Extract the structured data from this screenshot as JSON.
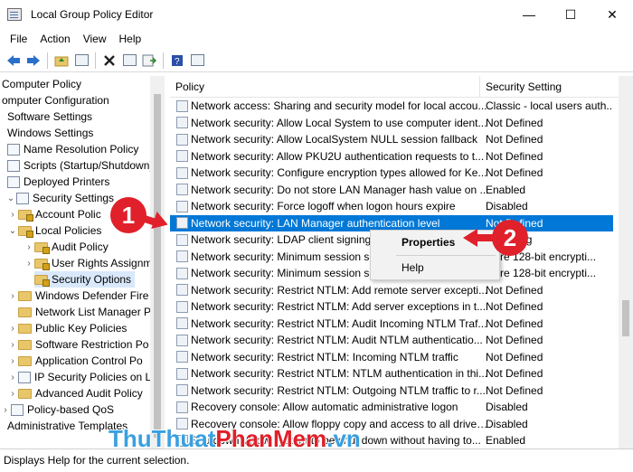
{
  "window": {
    "title": "Local Group Policy Editor",
    "minimize": "—",
    "maximize": "☐",
    "close": "✕"
  },
  "menu": [
    "File",
    "Action",
    "View",
    "Help"
  ],
  "tree": [
    {
      "label": "Computer Policy",
      "chev": ""
    },
    {
      "label": "omputer Configuration",
      "chev": ""
    },
    {
      "label": "Software Settings",
      "chev": ""
    },
    {
      "label": "Windows Settings",
      "chev": ""
    },
    {
      "label": "Name Resolution Policy",
      "chev": ""
    },
    {
      "label": "Scripts (Startup/Shutdown)",
      "chev": ""
    },
    {
      "label": "Deployed Printers",
      "chev": ""
    },
    {
      "label": "Security Settings",
      "chev": "⌄"
    },
    {
      "label": "Account Polic",
      "chev": "›"
    },
    {
      "label": "Local Policies",
      "chev": "⌄"
    },
    {
      "label": "Audit Policy",
      "chev": "›"
    },
    {
      "label": "User Rights Assignm",
      "chev": "›"
    },
    {
      "label": "Security Options",
      "chev": ""
    },
    {
      "label": "Windows Defender Fire",
      "chev": "›"
    },
    {
      "label": "Network List Manager P",
      "chev": ""
    },
    {
      "label": "Public Key Policies",
      "chev": "›"
    },
    {
      "label": "Software Restriction Po",
      "chev": "›"
    },
    {
      "label": "Application Control Po",
      "chev": "›"
    },
    {
      "label": "IP Security Policies on L",
      "chev": "›"
    },
    {
      "label": "Advanced Audit Policy",
      "chev": "›"
    },
    {
      "label": "Policy-based QoS",
      "chev": "›"
    },
    {
      "label": "Administrative Templates",
      "chev": ""
    }
  ],
  "columns": {
    "policy": "Policy",
    "setting": "Security Setting"
  },
  "rows": [
    {
      "policy": "Network access: Sharing and security model for local accou...",
      "setting": "Classic - local users auth..."
    },
    {
      "policy": "Network security: Allow Local System to use computer ident...",
      "setting": "Not Defined"
    },
    {
      "policy": "Network security: Allow LocalSystem NULL session fallback",
      "setting": "Not Defined"
    },
    {
      "policy": "Network security: Allow PKU2U authentication requests to t...",
      "setting": "Not Defined"
    },
    {
      "policy": "Network security: Configure encryption types allowed for Ke...",
      "setting": "Not Defined"
    },
    {
      "policy": "Network security: Do not store LAN Manager hash value on ...",
      "setting": "Enabled"
    },
    {
      "policy": "Network security: Force logoff when logon hours expire",
      "setting": "Disabled"
    },
    {
      "policy": "Network security: LAN Manager authentication level",
      "setting": "Not Defined"
    },
    {
      "policy": "Network security: LDAP client signing r",
      "setting": "te signing"
    },
    {
      "policy": "Network security: Minimum session se",
      "setting": "quire 128-bit encrypti..."
    },
    {
      "policy": "Network security: Minimum session se",
      "setting": "quire 128-bit encrypti..."
    },
    {
      "policy": "Network security: Restrict NTLM: Add remote server excepti...",
      "setting": "Not Defined"
    },
    {
      "policy": "Network security: Restrict NTLM: Add server exceptions in t...",
      "setting": "Not Defined"
    },
    {
      "policy": "Network security: Restrict NTLM: Audit Incoming NTLM Traf...",
      "setting": "Not Defined"
    },
    {
      "policy": "Network security: Restrict NTLM: Audit NTLM authenticatio...",
      "setting": "Not Defined"
    },
    {
      "policy": "Network security: Restrict NTLM: Incoming NTLM traffic",
      "setting": "Not Defined"
    },
    {
      "policy": "Network security: Restrict NTLM: NTLM authentication in thi...",
      "setting": "Not Defined"
    },
    {
      "policy": "Network security: Restrict NTLM: Outgoing NTLM traffic to r...",
      "setting": "Not Defined"
    },
    {
      "policy": "Recovery console: Allow automatic administrative logon",
      "setting": "Disabled"
    },
    {
      "policy": "Recovery console: Allow floppy copy and access to all drives...",
      "setting": "Disabled"
    },
    {
      "policy": "Shutdown: Allow system to be shut down without having to...",
      "setting": "Enabled"
    }
  ],
  "context_menu": {
    "properties": "Properties",
    "help": "Help"
  },
  "callouts": {
    "step1": "1",
    "step2": "2"
  },
  "watermark": {
    "part1": "ThuThuat",
    "part2": "PhanMem",
    "part3": ".vn"
  },
  "status": "Displays Help for the current selection.",
  "colors": {
    "selection": "#0078d7",
    "callout": "#e0202a"
  }
}
